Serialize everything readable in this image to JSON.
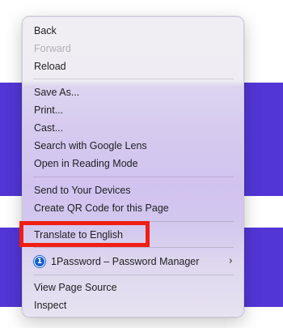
{
  "menu": {
    "back": "Back",
    "forward": "Forward",
    "reload": "Reload",
    "save_as": "Save As...",
    "print": "Print...",
    "cast": "Cast...",
    "search_lens": "Search with Google Lens",
    "reading_mode": "Open in Reading Mode",
    "send_devices": "Send to Your Devices",
    "qr_code": "Create QR Code for this Page",
    "translate": "Translate to English",
    "password_manager": "1Password – Password Manager",
    "password_icon": "1",
    "submenu_arrow": "›",
    "view_source": "View Page Source",
    "inspect": "Inspect"
  },
  "colors": {
    "background_band": "#5236d6",
    "highlight_border": "#f01e14",
    "password_icon": "#1a5fd0"
  }
}
